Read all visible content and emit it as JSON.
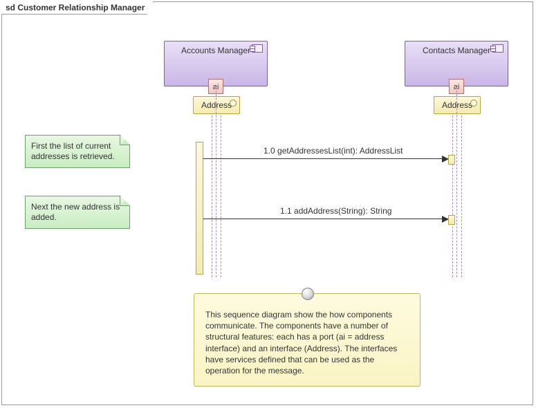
{
  "frame": {
    "title": "sd Customer Relationship Manager"
  },
  "participants": {
    "accounts": {
      "name": "Accounts Manager",
      "port": "ai",
      "interface": "Address"
    },
    "contacts": {
      "name": "Contacts Manager",
      "port": "ai",
      "interface": "Address"
    }
  },
  "notes": {
    "n1": "First the list of current addresses is retrieved.",
    "n2": "Next the new address is added.",
    "main": "This sequence diagram show the how components communicate. The components have a number of structural features: each has a port (ai = address interface) and an interface (Address). The interfaces have services defined that can be used as the operation for the message."
  },
  "messages": {
    "m1": {
      "label": "1.0 getAddressesList(int): AddressList"
    },
    "m2": {
      "label": "1.1 addAddress(String): String"
    }
  }
}
